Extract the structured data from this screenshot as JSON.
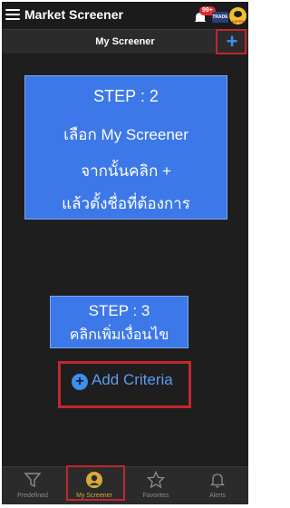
{
  "app": {
    "title": "Market Screener",
    "notification_badge": "99+",
    "trade_logo_text": "TRADE",
    "brand_logo_text": "ASPEN"
  },
  "header": {
    "screen_title": "My Screener",
    "add_button_symbol": "+"
  },
  "step2": {
    "line1": "STEP : 2",
    "line2": "เลือก My Screener",
    "line3": "จากนั้นคลิก +",
    "line4": "แล้วตั้งชื่อที่ต้องการ"
  },
  "step3": {
    "line1": "STEP : 3",
    "line2": "คลิกเพิ่มเงื่อนไข"
  },
  "criteria": {
    "label": "Add Criteria",
    "icon_symbol": "+"
  },
  "bottom_nav": {
    "items": [
      {
        "label": "Predefined",
        "icon": "filter-icon"
      },
      {
        "label": "My Screener",
        "icon": "user-icon",
        "active": true
      },
      {
        "label": "Favorites",
        "icon": "star-icon"
      },
      {
        "label": "Alerts",
        "icon": "bell-icon"
      }
    ]
  },
  "colors": {
    "accent_blue": "#3d8ef0",
    "highlight_red": "#c0282d",
    "active_gold": "#d9a93a",
    "callout_blue": "#3d78e8"
  }
}
